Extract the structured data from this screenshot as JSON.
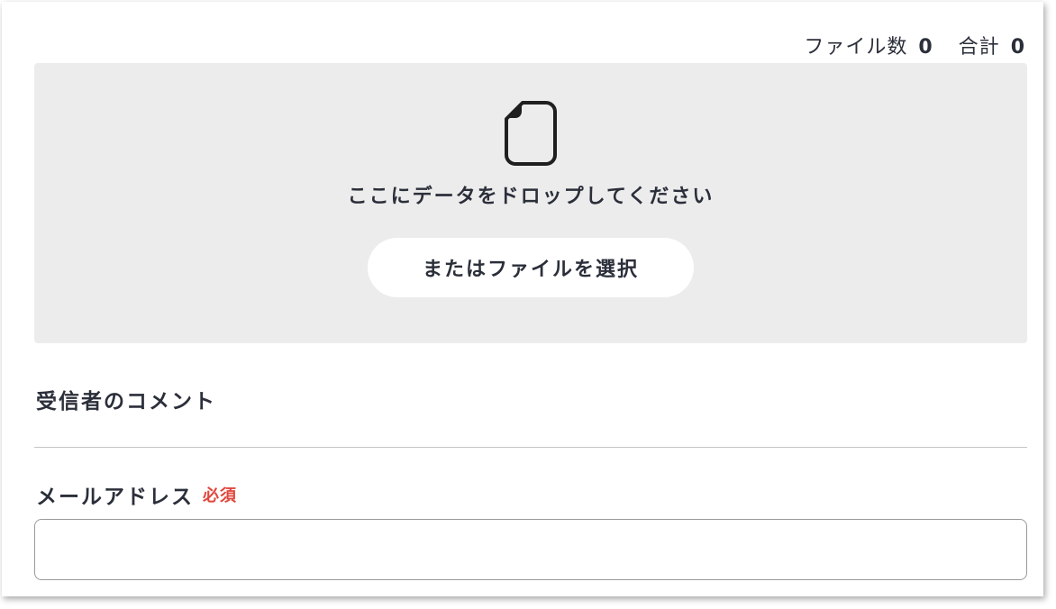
{
  "counts": {
    "file_count_label": "ファイル数",
    "file_count_value": "0",
    "total_label": "合計",
    "total_value": "0"
  },
  "dropzone": {
    "icon": "file-icon",
    "message": "ここにデータをドロップしてください",
    "select_button_label": "またはファイルを選択"
  },
  "comment": {
    "label": "受信者のコメント"
  },
  "email": {
    "label": "メールアドレス",
    "required_badge": "必須",
    "value": "",
    "placeholder": ""
  },
  "colors": {
    "text": "#2b2f3a",
    "dropzone_bg": "#ececec",
    "required": "#e0473d",
    "input_border": "#9a9a9a"
  }
}
